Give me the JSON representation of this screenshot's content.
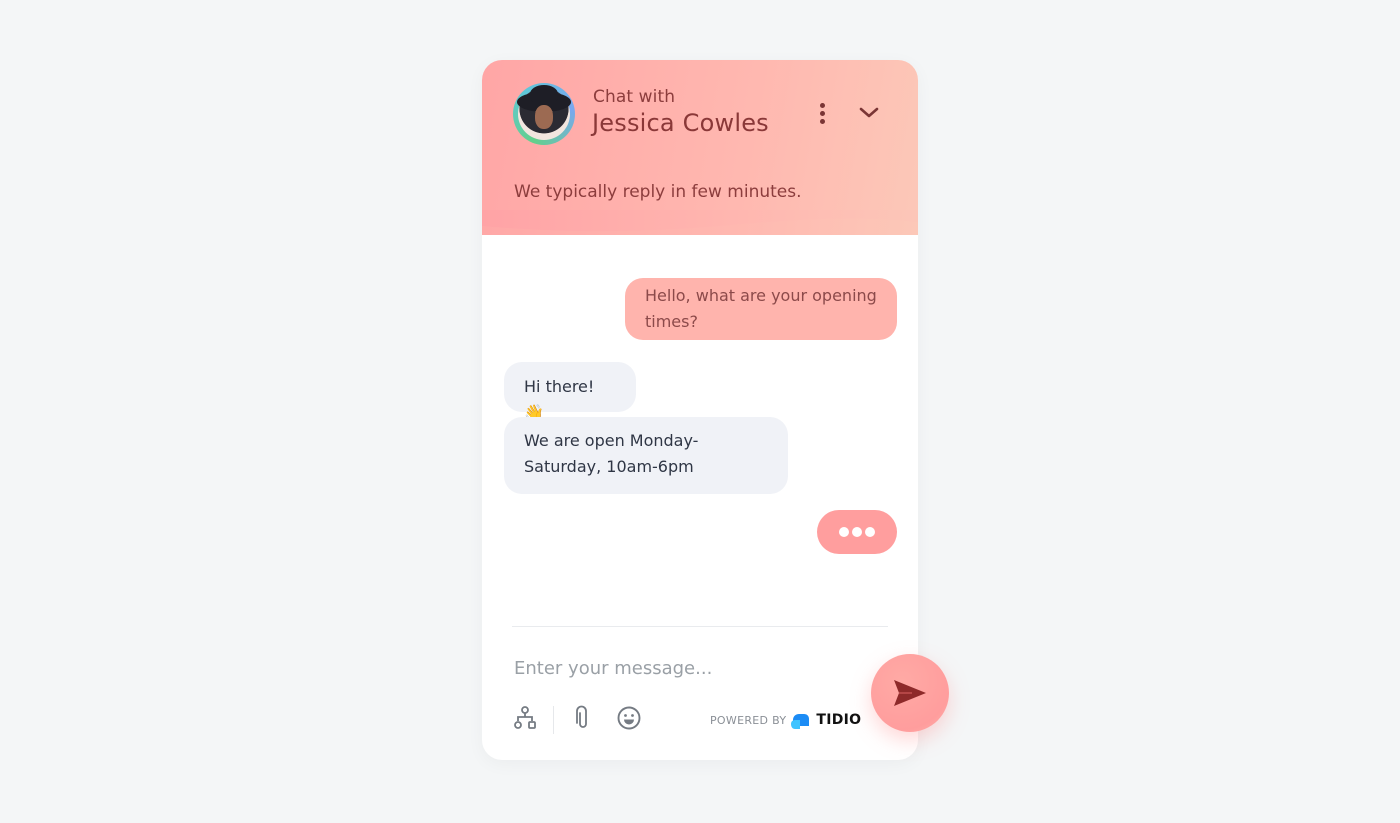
{
  "header": {
    "subtitle": "Chat with",
    "agent_name": "Jessica Cowles",
    "reply_note": "We typically reply in few minutes.",
    "menu_icon": "vertical-ellipsis-icon",
    "collapse_icon": "chevron-down-icon"
  },
  "messages": [
    {
      "sender": "visitor",
      "text": "Hello, what are your opening times?"
    },
    {
      "sender": "operator",
      "text": "Hi there! 👋"
    },
    {
      "sender": "operator",
      "text": "We are open Monday-Saturday, 10am-6pm"
    }
  ],
  "typing_indicator": {
    "sender": "visitor",
    "icon": "typing-dots-icon"
  },
  "composer": {
    "placeholder": "Enter your message...",
    "value": "",
    "tools": [
      "flows-icon",
      "paperclip-icon",
      "emoji-icon"
    ],
    "send_icon": "send-icon"
  },
  "branding": {
    "powered_by": "POWERED BY",
    "brand": "TIDIO"
  },
  "colors": {
    "header_gradient_start": "#ffa6a6",
    "header_gradient_end": "#fcc8b8",
    "visitor_bubble": "#ffb4ad",
    "operator_bubble": "#f0f2f7",
    "typing_bubble": "#ff9e9e",
    "header_text": "#8a3838",
    "brand_blue": "#1c8cf5"
  }
}
